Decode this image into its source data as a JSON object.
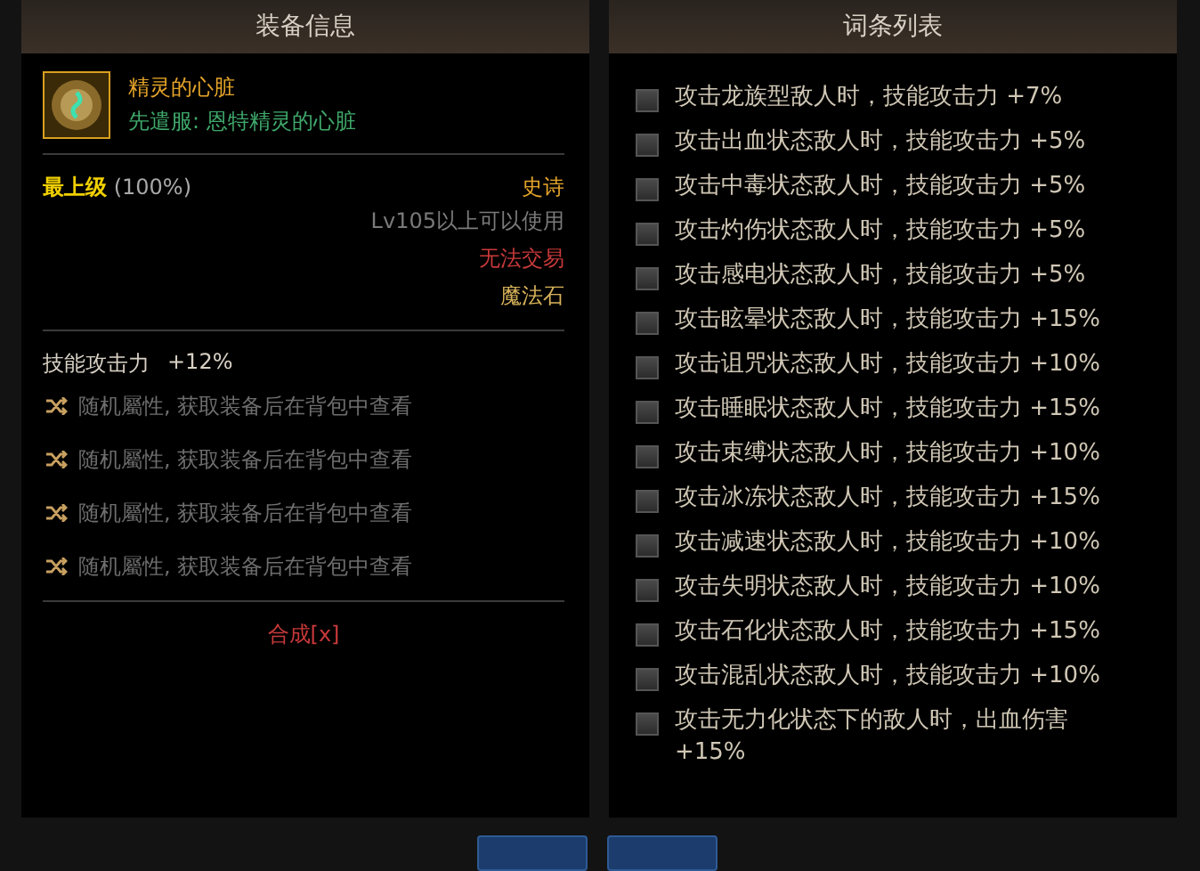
{
  "equipment_panel": {
    "title": "装备信息",
    "item": {
      "name": "精灵的心脏",
      "origin": "先遣服: 恩特精灵的心脏"
    },
    "grade": {
      "label": "最上级",
      "percent": "(100%)"
    },
    "meta": [
      {
        "kind": "rarity",
        "text": "史诗"
      },
      {
        "kind": "requirement",
        "text": "Lv105以上可以使用"
      },
      {
        "kind": "trade",
        "text": "无法交易"
      },
      {
        "kind": "type",
        "text": "魔法石"
      }
    ],
    "stat": {
      "name": "技能攻击力",
      "value": "+12%"
    },
    "random_props": [
      "随机屬性, 获取装备后在背包中查看",
      "随机屬性, 获取装备后在背包中查看",
      "随机屬性, 获取装备后在背包中查看",
      "随机屬性, 获取装备后在背包中查看"
    ],
    "synthesis_link": "合成[x]"
  },
  "affix_panel": {
    "title": "词条列表",
    "items": [
      {
        "text": "攻击龙族型敌人时，技能攻击力 +7%",
        "checked": false
      },
      {
        "text": "攻击出血状态敌人时，技能攻击力 +5%",
        "checked": false
      },
      {
        "text": "攻击中毒状态敌人时，技能攻击力 +5%",
        "checked": false
      },
      {
        "text": "攻击灼伤状态敌人时，技能攻击力 +5%",
        "checked": false
      },
      {
        "text": "攻击感电状态敌人时，技能攻击力 +5%",
        "checked": false
      },
      {
        "text": "攻击眩晕状态敌人时，技能攻击力 +15%",
        "checked": false
      },
      {
        "text": "攻击诅咒状态敌人时，技能攻击力 +10%",
        "checked": false
      },
      {
        "text": "攻击睡眠状态敌人时，技能攻击力 +15%",
        "checked": false
      },
      {
        "text": "攻击束缚状态敌人时，技能攻击力 +10%",
        "checked": false
      },
      {
        "text": "攻击冰冻状态敌人时，技能攻击力 +15%",
        "checked": false
      },
      {
        "text": "攻击减速状态敌人时，技能攻击力 +10%",
        "checked": false
      },
      {
        "text": "攻击失明状态敌人时，技能攻击力 +10%",
        "checked": false
      },
      {
        "text": "攻击石化状态敌人时，技能攻击力 +15%",
        "checked": false
      },
      {
        "text": "攻击混乱状态敌人时，技能攻击力 +10%",
        "checked": false
      },
      {
        "text": "攻击无力化状态下的敌人时，出血伤害 +15%",
        "checked": false
      }
    ]
  }
}
